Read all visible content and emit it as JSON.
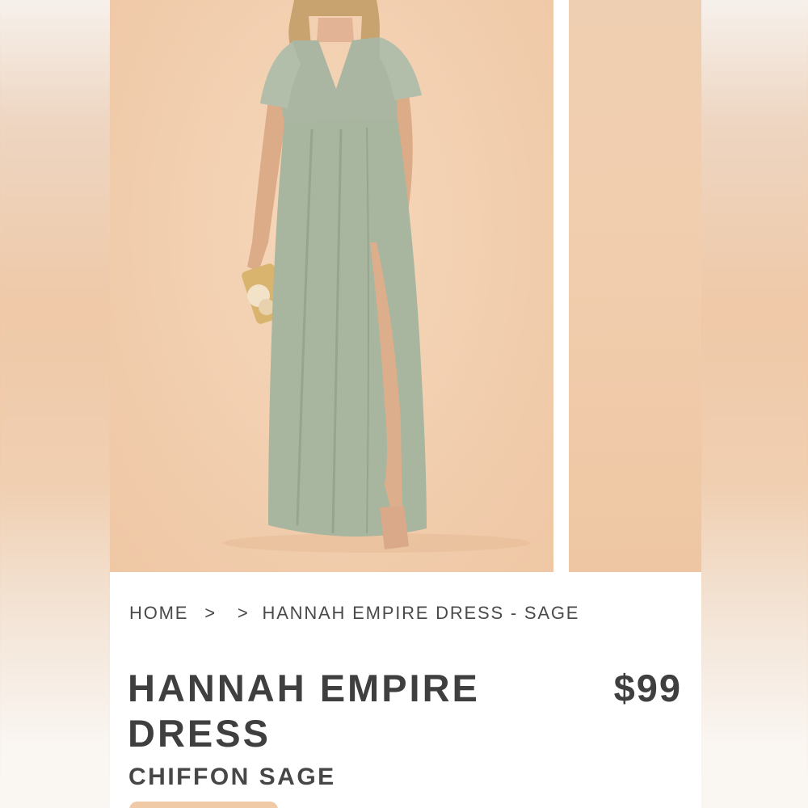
{
  "breadcrumb": {
    "home": "HOME",
    "separator_1": ">",
    "separator_2": ">",
    "current": "HANNAH EMPIRE DRESS - SAGE"
  },
  "product": {
    "title": "HANNAH EMPIRE DRESS",
    "price": "$99",
    "subtitle": "CHIFFON SAGE"
  },
  "colors": {
    "background_peach": "#f1ceae",
    "dress_sage": "#a9b5a0",
    "text_dark": "#3f3f3f"
  },
  "icons": {
    "breadcrumb_separator": "chevron-right-icon"
  }
}
